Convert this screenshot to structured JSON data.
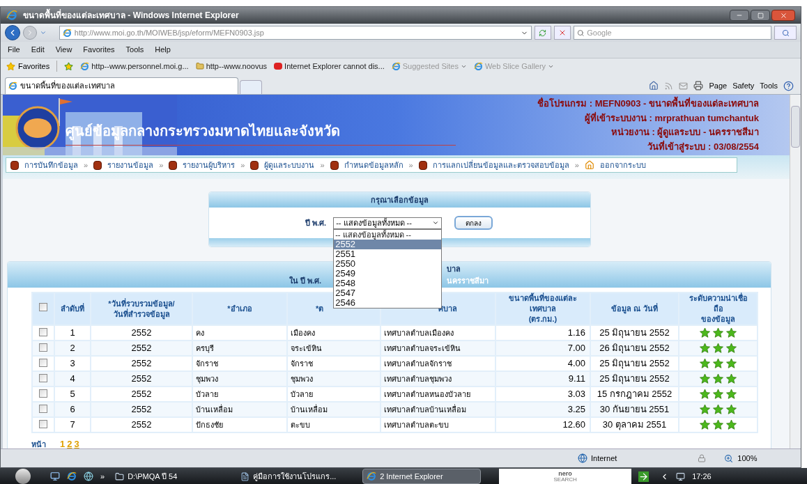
{
  "window": {
    "title": "ขนาดพื้นที่ของแต่ละเทศบาล - Windows Internet Explorer"
  },
  "address_bar": {
    "url": "http://www.moi.go.th/MOIWEB/jsp/eform/MEFN0903.jsp"
  },
  "search": {
    "placeholder": "Google"
  },
  "menu_bar": [
    "File",
    "Edit",
    "View",
    "Favorites",
    "Tools",
    "Help"
  ],
  "favorites_bar": {
    "label": "Favorites",
    "links": [
      {
        "label": "http--www.personnel.moi.g...",
        "kind": "ie"
      },
      {
        "label": "http--www.noovus",
        "kind": "folder"
      },
      {
        "label": "Internet Explorer cannot dis...",
        "kind": "youtube"
      },
      {
        "label": "Suggested Sites",
        "kind": "menu"
      },
      {
        "label": "Web Slice Gallery",
        "kind": "menu"
      }
    ]
  },
  "tabs": [
    {
      "label": "ขนาดพื้นที่ของแต่ละเทศบาล",
      "selected": true
    }
  ],
  "command_bar": [
    "Page",
    "Safety",
    "Tools"
  ],
  "page": {
    "banner_title": "ศูนย์ข้อมูลกลางกระทรวงมหาดไทยและจังหวัด",
    "info_lines": [
      "ชื่อโปรแกรม : MEFN0903 - ขนาดพื้นที่ของแต่ละเทศบาล",
      "ผู้ที่เข้าระบบงาน : mrprathuan tumchantuk",
      "หน่วยงาน : ผู้ดูแลระบบ - นครราชสีมา",
      "วันที่เข้าสู่ระบบ : 03/08/2554"
    ],
    "nav_items": [
      {
        "label": "การบันทึกข้อมูล",
        "kind": "item"
      },
      {
        "label": "รายงานข้อมูล",
        "kind": "item"
      },
      {
        "label": "รายงานผู้บริหาร",
        "kind": "item"
      },
      {
        "label": "ผู้ดูแลระบบงาน",
        "kind": "item"
      },
      {
        "label": "กำหนดข้อมูลหลัก",
        "kind": "item"
      },
      {
        "label": "การแลกเปลี่ยนข้อมูลและตรวจสอบข้อมูล",
        "kind": "item"
      },
      {
        "label": "ออกจากระบบ",
        "kind": "exit"
      }
    ],
    "nav_separator": "»",
    "filter_panel": {
      "title": "กรุณาเลือกข้อมูล",
      "label": "ปี พ.ศ.",
      "select_value": "-- แสดงข้อมูลทั้งหมด --",
      "button": "ตกลง",
      "dropdown_options": [
        {
          "label": "-- แสดงข้อมูลทั้งหมด --",
          "selected": false
        },
        {
          "label": "2552",
          "selected": true
        },
        {
          "label": "2551",
          "selected": false
        },
        {
          "label": "2550",
          "selected": false
        },
        {
          "label": "2549",
          "selected": false
        },
        {
          "label": "2548",
          "selected": false
        },
        {
          "label": "2547",
          "selected": false
        },
        {
          "label": "2546",
          "selected": false
        }
      ]
    },
    "report": {
      "title": "บาล",
      "subtitle_left": "ใน ปี พ.ศ.",
      "subtitle_right": "นครราชสีมา",
      "select_all": {
        "checked": false
      },
      "columns": [
        {
          "kind": "text",
          "lines": [
            "ลำดับที่"
          ]
        },
        {
          "kind": "text",
          "lines": [
            "*วันที่รวบรวมข้อมูล/",
            "วันที่สำรวจข้อมูล"
          ]
        },
        {
          "kind": "text",
          "lines": [
            "*อำเภอ"
          ]
        },
        {
          "kind": "text",
          "lines": [
            "*ต"
          ]
        },
        {
          "kind": "text",
          "lines": [
            "ศบาล"
          ]
        },
        {
          "kind": "text",
          "lines": [
            "ขนาดพื้นที่ของแต่ละ",
            "เทศบาล",
            "(ตร.กม.)"
          ]
        },
        {
          "kind": "text",
          "lines": [
            "ข้อมูล ณ วันที่"
          ]
        },
        {
          "kind": "text",
          "lines": [
            "ระดับความน่าเชื่อ",
            "ถือ",
            "ของข้อมูล"
          ]
        }
      ],
      "rows": [
        {
          "checked": false,
          "cells": [
            "1",
            "2552",
            "คง",
            "เมืองคง",
            "เทศบาลตำบลเมืองคง",
            "1.16",
            "25 มิถุนายน 2552"
          ],
          "stars": 3
        },
        {
          "checked": false,
          "cells": [
            "2",
            "2552",
            "ครบุรี",
            "จระเข้หิน",
            "เทศบาลตำบลจระเข้หิน",
            "7.00",
            "26 มิถุนายน 2552"
          ],
          "stars": 3
        },
        {
          "checked": false,
          "cells": [
            "3",
            "2552",
            "จักราช",
            "จักราช",
            "เทศบาลตำบลจักราช",
            "4.00",
            "25 มิถุนายน 2552"
          ],
          "stars": 3
        },
        {
          "checked": false,
          "cells": [
            "4",
            "2552",
            "ชุมพวง",
            "ชุมพวง",
            "เทศบาลตำบลชุมพวง",
            "9.11",
            "25 มิถุนายน 2552"
          ],
          "stars": 3
        },
        {
          "checked": false,
          "cells": [
            "5",
            "2552",
            "บัวลาย",
            "บัวลาย",
            "เทศบาลตำบลหนองบัวลาย",
            "3.03",
            "15 กรกฎาคม 2552"
          ],
          "stars": 3
        },
        {
          "checked": false,
          "cells": [
            "6",
            "2552",
            "บ้านเหลื่อม",
            "บ้านเหลื่อม",
            "เทศบาลตำบลบ้านเหลื่อม",
            "3.25",
            "30 กันยายน 2551"
          ],
          "stars": 3
        },
        {
          "checked": false,
          "cells": [
            "7",
            "2552",
            "ปักธงชัย",
            "ตะขบ",
            "เทศบาลตำบลตะขบ",
            "12.60",
            "30 ตุลาคม 2551"
          ],
          "stars": 3
        }
      ]
    },
    "pagination": {
      "label": "หน้า",
      "pages": [
        {
          "label": "1",
          "selected": true
        },
        {
          "label": "2",
          "selected": false
        },
        {
          "label": "3",
          "selected": false
        }
      ]
    }
  },
  "status_bar": {
    "zone": "Internet",
    "zoom": "100%"
  },
  "taskbar": {
    "overflow": "»",
    "items": [
      {
        "label": "D:\\PMQA ปี 54",
        "kind": "folder",
        "selected": false
      },
      {
        "label": "คู่มือการใช้งานโปรแกร...",
        "kind": "word",
        "selected": false
      },
      {
        "label": "2 Internet Explorer",
        "kind": "ie",
        "selected": true
      }
    ],
    "search_logo": [
      "nero",
      "SEARCH"
    ],
    "clock": "17:26"
  }
}
